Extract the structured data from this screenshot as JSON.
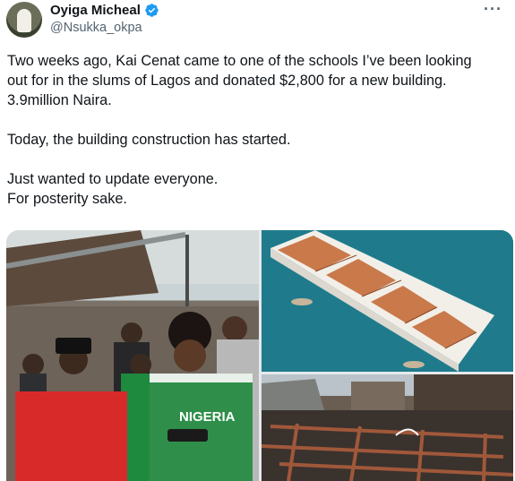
{
  "author": {
    "display_name": "Oyiga Micheal",
    "handle": "@Nsukka_okpa",
    "avatar_icon": "profile-photo",
    "verified_icon": "verified-badge-icon"
  },
  "actions": {
    "more_icon": "more-options-icon",
    "more_label": "···"
  },
  "tweet": {
    "lines": [
      "Two weeks ago, Kai Cenat came to one of the schools I’ve been looking",
      "out for in the slums of Lagos and donated $2,800 for a new building.",
      "3.9million Naira.",
      "",
      "Today, the building construction has started.",
      "",
      "Just wanted to update everyone.",
      "For posterity sake."
    ]
  },
  "media": {
    "photos": [
      {
        "icon": "crowd-photo",
        "jersey_text": "NIGERIA"
      },
      {
        "icon": "building-model-photo"
      },
      {
        "icon": "construction-site-photo"
      }
    ]
  },
  "colors": {
    "text": "#0f1419",
    "secondary": "#536471",
    "verified": "#1d9bf0"
  }
}
